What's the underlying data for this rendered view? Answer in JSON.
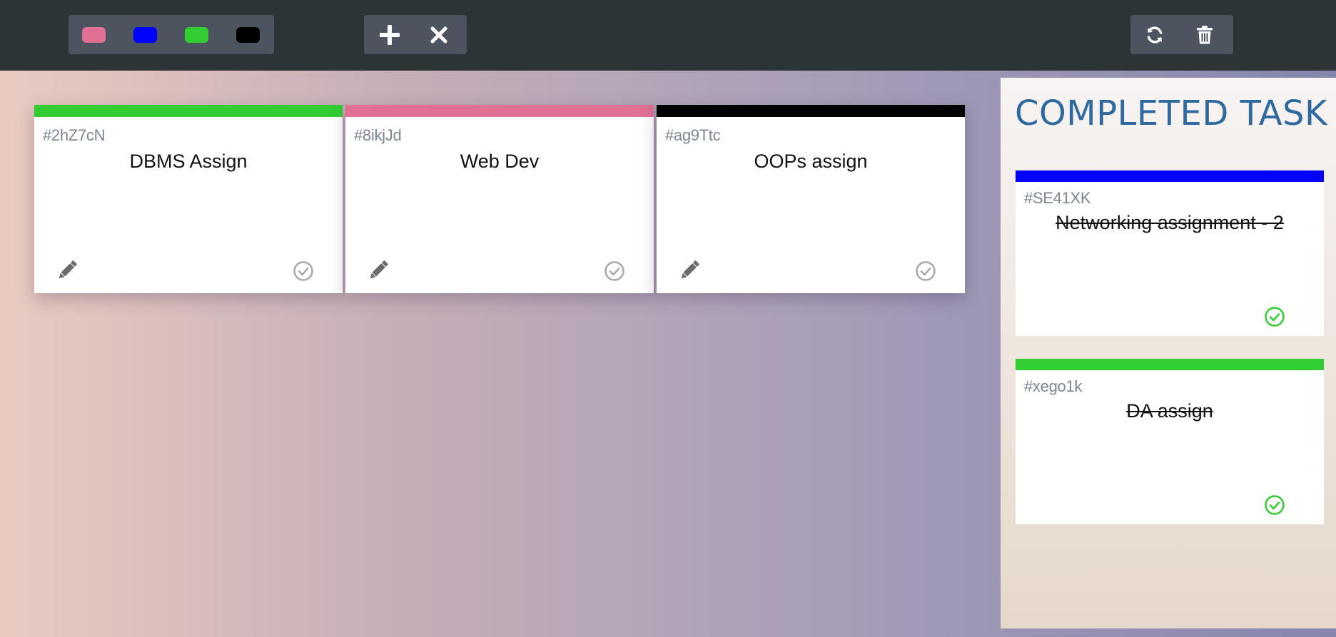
{
  "toolbar": {
    "colors": [
      {
        "name": "pink",
        "hex": "#e07194"
      },
      {
        "name": "blue",
        "hex": "#0000ff"
      },
      {
        "name": "green",
        "hex": "#32cd32"
      },
      {
        "name": "black",
        "hex": "#000000"
      }
    ],
    "actions": {
      "add_icon": "plus-icon",
      "remove_icon": "close-icon"
    },
    "utilities": {
      "refresh_icon": "refresh-icon",
      "delete_icon": "trash-icon"
    }
  },
  "tickets": [
    {
      "color": "#32cd32",
      "id": "#2hZ7cN",
      "title": "DBMS Assign"
    },
    {
      "color": "#e07194",
      "id": "#8ikjJd",
      "title": "Web Dev"
    },
    {
      "color": "#000000",
      "id": "#ag9Ttc",
      "title": "OOPs assign"
    }
  ],
  "completed": {
    "title": "COMPLETED TASK",
    "items": [
      {
        "color": "#0000ff",
        "id": "#SE41XK",
        "title": "Networking assignment - 2"
      },
      {
        "color": "#32cd32",
        "id": "#xego1k",
        "title": "DA assign"
      }
    ]
  },
  "colors": {
    "topbar": "#2d3436",
    "toolgroup": "#4c545f",
    "id_text": "#7b8595",
    "completed_title": "#2e6a9f",
    "pending_check": "#a8a8a8",
    "done_check": "#32cd32"
  }
}
